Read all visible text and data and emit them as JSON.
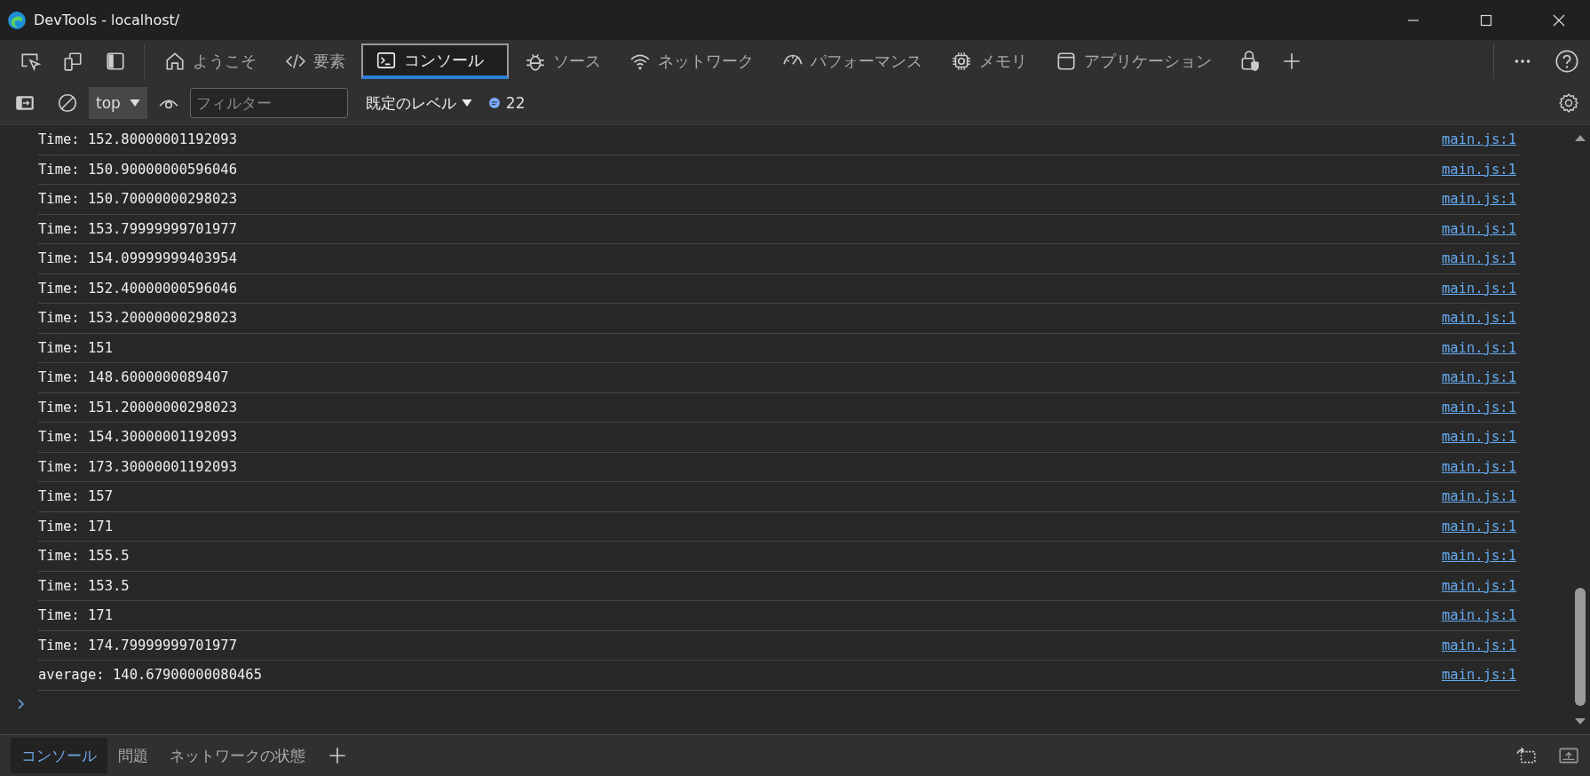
{
  "window": {
    "title": "DevTools - localhost/"
  },
  "tabs": [
    {
      "kind": "welcome",
      "label": "ようこそ",
      "selected": false
    },
    {
      "kind": "elements",
      "label": "要素",
      "selected": false
    },
    {
      "kind": "console",
      "label": "コンソール",
      "selected": true
    },
    {
      "kind": "sources",
      "label": "ソース",
      "selected": false
    },
    {
      "kind": "network",
      "label": "ネットワーク",
      "selected": false
    },
    {
      "kind": "performance",
      "label": "パフォーマンス",
      "selected": false
    },
    {
      "kind": "memory",
      "label": "メモリ",
      "selected": false
    },
    {
      "kind": "application",
      "label": "アプリケーション",
      "selected": false
    }
  ],
  "console_toolbar": {
    "context": "top",
    "filter": {
      "placeholder": "フィルター"
    },
    "levels": "既定のレベル",
    "message_count": "22"
  },
  "messages": [
    {
      "text": "Time: 152.80000001192093",
      "source": "main.js:1"
    },
    {
      "text": "Time: 150.90000000596046",
      "source": "main.js:1"
    },
    {
      "text": "Time: 150.70000000298023",
      "source": "main.js:1"
    },
    {
      "text": "Time: 153.79999999701977",
      "source": "main.js:1"
    },
    {
      "text": "Time: 154.09999999403954",
      "source": "main.js:1"
    },
    {
      "text": "Time: 152.40000000596046",
      "source": "main.js:1"
    },
    {
      "text": "Time: 153.20000000298023",
      "source": "main.js:1"
    },
    {
      "text": "Time: 151",
      "source": "main.js:1"
    },
    {
      "text": "Time: 148.6000000089407",
      "source": "main.js:1"
    },
    {
      "text": "Time: 151.20000000298023",
      "source": "main.js:1"
    },
    {
      "text": "Time: 154.30000001192093",
      "source": "main.js:1"
    },
    {
      "text": "Time: 173.30000001192093",
      "source": "main.js:1"
    },
    {
      "text": "Time: 157",
      "source": "main.js:1"
    },
    {
      "text": "Time: 171",
      "source": "main.js:1"
    },
    {
      "text": "Time: 155.5",
      "source": "main.js:1"
    },
    {
      "text": "Time: 153.5",
      "source": "main.js:1"
    },
    {
      "text": "Time: 171",
      "source": "main.js:1"
    },
    {
      "text": "Time: 174.79999999701977",
      "source": "main.js:1"
    },
    {
      "text": "average: 140.67900000080465",
      "source": "main.js:1"
    }
  ],
  "drawer_tabs": [
    {
      "label": "コンソール",
      "selected": true
    },
    {
      "label": "問題",
      "selected": false
    },
    {
      "label": "ネットワークの状態",
      "selected": false
    }
  ]
}
